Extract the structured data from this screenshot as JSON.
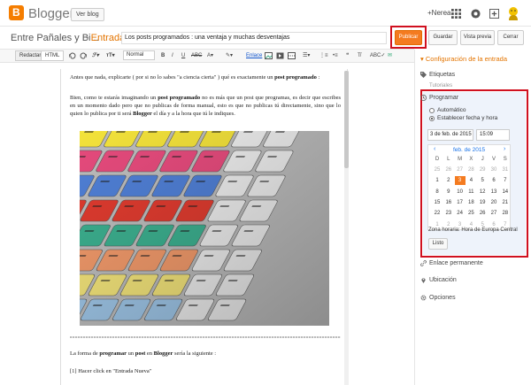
{
  "app": {
    "brand": "Blogger",
    "view_blog": "Ver blog",
    "user": "+Nerea"
  },
  "post": {
    "blog_name": "Entre Pañales y Bi...",
    "crumb_separator": "›",
    "crumb": "Entrada",
    "title": "Los posts programados : una ventaja y muchas desventajas"
  },
  "actions": {
    "publish": "Publicar",
    "save": "Guardar",
    "preview": "Vista previa",
    "cancel": "Cerrar"
  },
  "toolbar": {
    "compose": "Redactar",
    "html": "HTML",
    "font": "Normal",
    "link": "Enlace"
  },
  "content": {
    "p1_pre": "Antes que nada, explicarte ( por si no lo sabes \"a ciencia cierta\" ) qué es exactamente un ",
    "p1_bold": "post programado",
    "p1_post": " :",
    "p2_a": "Bien, como te estarás imaginando un ",
    "p2_b": "post programado",
    "p2_c": " no es más que un post que programas, es decir que escribes en un momento dado pero que no publicas de forma manual, esto es que no publicas tú directamente, sino que lo quien lo publica por ti será ",
    "p2_d": "Blogger",
    "p2_e": " el día y a la hora que tú le indiques.",
    "p3_a": "La forma de ",
    "p3_b": "programar",
    "p3_c": " un ",
    "p3_d": "post",
    "p3_e": " en ",
    "p3_f": "Blogger",
    "p3_g": " sería la siguiente :",
    "p4": "[1] Hacer click en \"Entrada Nueva\""
  },
  "sidebar": {
    "heading": "Configuración de la entrada",
    "labels": "Etiquetas",
    "labels_hint": "Tutoriales",
    "schedule": "Programar",
    "auto": "Automático",
    "set_date": "Establecer fecha y hora",
    "date": "3 de feb. de 2015",
    "time": "15:09",
    "month": "feb. de 2015",
    "prev": "‹",
    "next": "›",
    "dow": [
      "D",
      "L",
      "M",
      "X",
      "J",
      "V",
      "S"
    ],
    "weeks": [
      [
        "25",
        "26",
        "27",
        "28",
        "29",
        "30",
        "31"
      ],
      [
        "1",
        "2",
        "3",
        "4",
        "5",
        "6",
        "7"
      ],
      [
        "8",
        "9",
        "10",
        "11",
        "12",
        "13",
        "14"
      ],
      [
        "15",
        "16",
        "17",
        "18",
        "19",
        "20",
        "21"
      ],
      [
        "22",
        "23",
        "24",
        "25",
        "26",
        "27",
        "28"
      ],
      [
        "1",
        "2",
        "3",
        "4",
        "5",
        "6",
        "7"
      ]
    ],
    "timezone": "Zona horaria: Hora de Europa Central",
    "done": "Listo",
    "permalink": "Enlace permanente",
    "location": "Ubicación",
    "options": "Opciones"
  },
  "colors": {
    "accent": "#f47b20",
    "highlight": "#d0101f",
    "link": "#1a73e8"
  }
}
